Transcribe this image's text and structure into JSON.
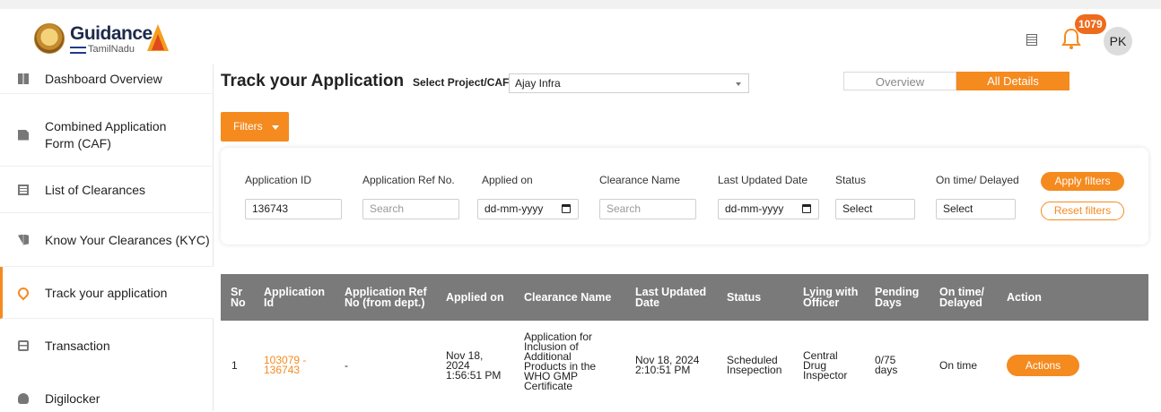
{
  "header": {
    "logo_text": "Guidance",
    "logo_sub": "TamilNadu",
    "notification_count": "1079",
    "avatar_initials": "PK"
  },
  "sidebar": {
    "items": [
      {
        "label": "Dashboard Overview",
        "icon": "dashboard-icon"
      },
      {
        "label": "Combined Application Form (CAF)",
        "icon": "document-icon"
      },
      {
        "label": "List of Clearances",
        "icon": "list-icon"
      },
      {
        "label": "Know Your Clearances (KYC)",
        "icon": "book-icon"
      },
      {
        "label": "Track your application",
        "icon": "location-pin-icon",
        "active": true
      },
      {
        "label": "Transaction",
        "icon": "transaction-icon"
      },
      {
        "label": "Digilocker",
        "icon": "cloud-icon"
      }
    ]
  },
  "main": {
    "title": "Track your Application",
    "select_label": "Select Project/CAF",
    "select_value": "Ajay Infra",
    "tabs": [
      {
        "label": "Overview",
        "active": false
      },
      {
        "label": "All Details",
        "active": true
      }
    ],
    "filters_button": "Filters"
  },
  "filters": {
    "labels": {
      "application_id": "Application ID",
      "application_ref": "Application Ref No.",
      "applied_on": "Applied on",
      "clearance_name": "Clearance Name",
      "last_updated": "Last Updated Date",
      "status": "Status",
      "ontime": "On time/ Delayed"
    },
    "values": {
      "application_id": "136743",
      "application_ref_placeholder": "Search",
      "applied_on": "dd-mm-yyyy",
      "clearance_name_placeholder": "Search",
      "last_updated": "dd-mm-yyyy",
      "status": "Select",
      "ontime": "Select"
    },
    "apply_label": "Apply filters",
    "reset_label": "Reset filters"
  },
  "table": {
    "columns": [
      "Sr No",
      "Application Id",
      "Application Ref No (from dept.)",
      "Applied on",
      "Clearance Name",
      "Last Updated Date",
      "Status",
      "Lying with Officer",
      "Pending Days",
      "On time/ Delayed",
      "Action"
    ],
    "rows": [
      {
        "sr": "1",
        "app_id": "103079 - 136743",
        "ref": "-",
        "applied": "Nov 18, 2024 1:56:51 PM",
        "clearance": "Application for Inclusion of Additional Products in the WHO GMP Certificate",
        "updated": "Nov 18, 2024 2:10:51 PM",
        "status": "Scheduled Insepection",
        "officer": "Central Drug Inspector",
        "pending": "0/75 days",
        "ontime": "On time",
        "action": "Actions"
      }
    ]
  },
  "colors": {
    "accent": "#f58a1f",
    "table_header": "#7a7a7a"
  }
}
